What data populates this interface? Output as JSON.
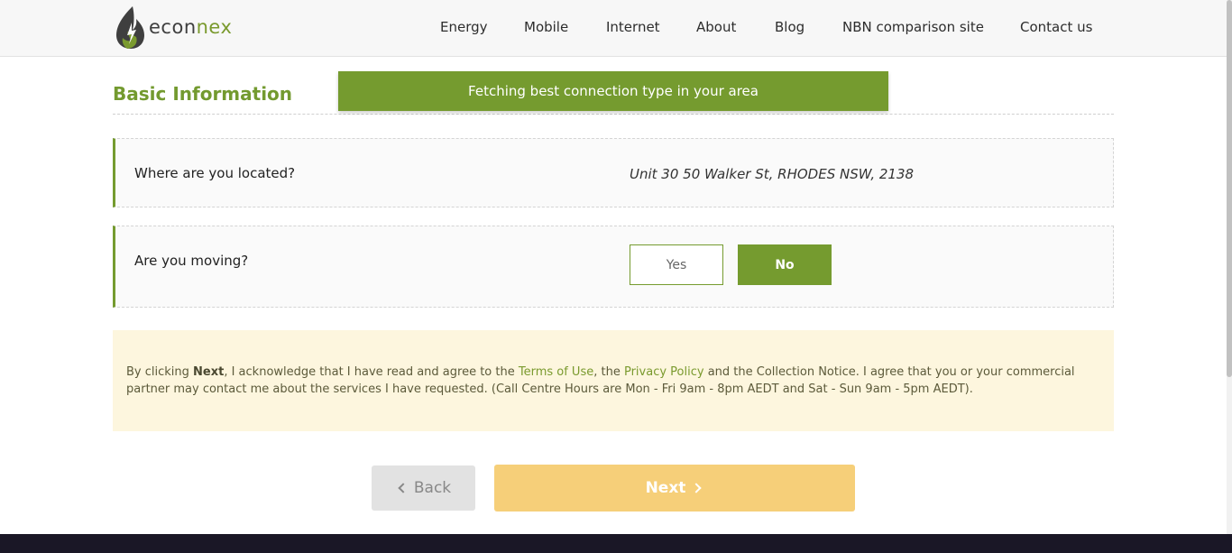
{
  "header": {
    "logo": {
      "part1": "econ",
      "part2": "nex"
    },
    "nav": [
      {
        "label": "Energy"
      },
      {
        "label": "Mobile"
      },
      {
        "label": "Internet"
      },
      {
        "label": "About"
      },
      {
        "label": "Blog"
      },
      {
        "label": "NBN comparison site"
      },
      {
        "label": "Contact us"
      }
    ]
  },
  "section": {
    "title": "Basic Information"
  },
  "toast": {
    "message": "Fetching best connection type in your area"
  },
  "questions": {
    "location": {
      "label": "Where are you located?",
      "value": "Unit 30 50 Walker St, RHODES NSW, 2138"
    },
    "moving": {
      "label": "Are you moving?",
      "yes_label": "Yes",
      "no_label": "No",
      "selected": "No"
    }
  },
  "consent": {
    "prefix": "By clicking ",
    "bold": "Next",
    "part1": ", I acknowledge that I have read and agree to the ",
    "terms_link": "Terms of Use",
    "part2": ", the ",
    "privacy_link": "Privacy Policy",
    "part3": " and the Collection Notice. I agree that you or your commercial partner may contact me about the services I have requested. (Call Centre Hours are Mon - Fri 9am - 8pm AEDT and Sat - Sun 9am - 5pm AEDT)."
  },
  "actions": {
    "back_label": "Back",
    "next_label": "Next"
  },
  "colors": {
    "brand_green": "#759b2f",
    "next_yellow": "#f6cf79",
    "consent_bg": "#fdf6de",
    "footer": "#1a1726"
  }
}
